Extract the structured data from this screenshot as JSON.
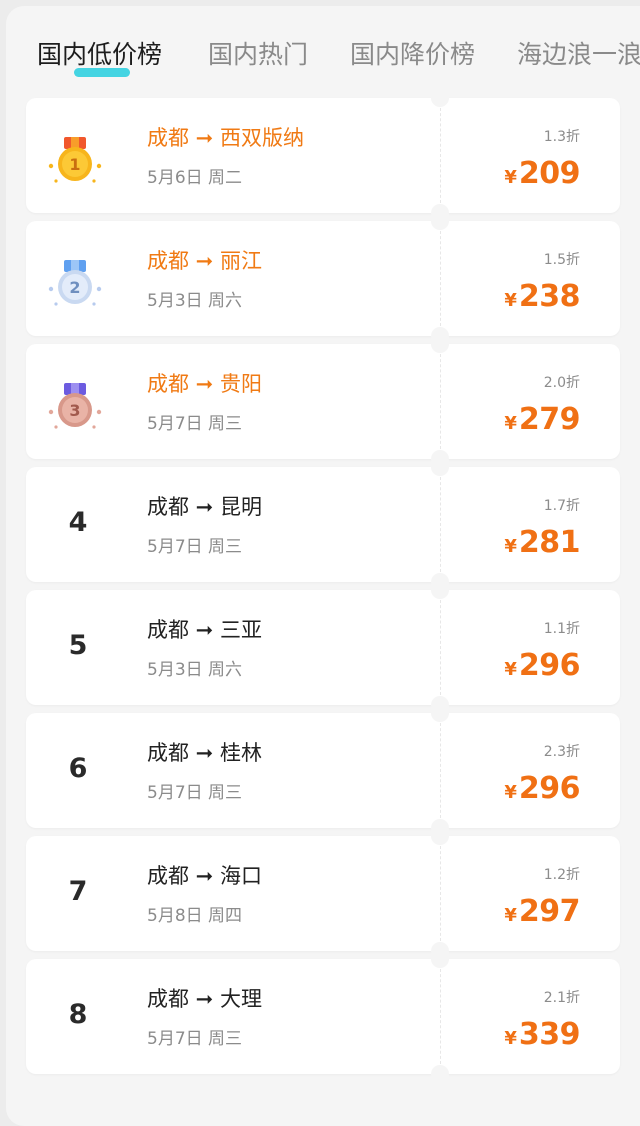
{
  "tabs": [
    {
      "label": "国内低价榜"
    },
    {
      "label": "国内热门"
    },
    {
      "label": "国内降价榜"
    },
    {
      "label": "海边浪一浪"
    }
  ],
  "active_tab": 0,
  "colors": {
    "highlight_route": "#f07a14",
    "price": "#f07014",
    "tab_underline": "#31d0e0",
    "medal_gold": "#f7b51c",
    "medal_silver": "#c9d9f1",
    "medal_bronze": "#d8988a"
  },
  "list": {
    "items": [
      {
        "rank": "1",
        "medal": "gold-medal-icon",
        "route": "成都 ➞ 西双版纳",
        "date": "5月6日 周二",
        "discount": "1.3折",
        "currency": "¥",
        "price": "209"
      },
      {
        "rank": "2",
        "medal": "silver-medal-icon",
        "route": "成都 ➞ 丽江",
        "date": "5月3日 周六",
        "discount": "1.5折",
        "currency": "¥",
        "price": "238"
      },
      {
        "rank": "3",
        "medal": "bronze-medal-icon",
        "route": "成都 ➞ 贵阳",
        "date": "5月7日 周三",
        "discount": "2.0折",
        "currency": "¥",
        "price": "279"
      },
      {
        "rank": "4",
        "route": "成都 ➞ 昆明",
        "date": "5月7日 周三",
        "discount": "1.7折",
        "currency": "¥",
        "price": "281"
      },
      {
        "rank": "5",
        "route": "成都 ➞ 三亚",
        "date": "5月3日 周六",
        "discount": "1.1折",
        "currency": "¥",
        "price": "296"
      },
      {
        "rank": "6",
        "route": "成都 ➞ 桂林",
        "date": "5月7日 周三",
        "discount": "2.3折",
        "currency": "¥",
        "price": "296"
      },
      {
        "rank": "7",
        "route": "成都 ➞ 海口",
        "date": "5月8日 周四",
        "discount": "1.2折",
        "currency": "¥",
        "price": "297"
      },
      {
        "rank": "8",
        "route": "成都 ➞ 大理",
        "date": "5月7日 周三",
        "discount": "2.1折",
        "currency": "¥",
        "price": "339"
      }
    ]
  }
}
